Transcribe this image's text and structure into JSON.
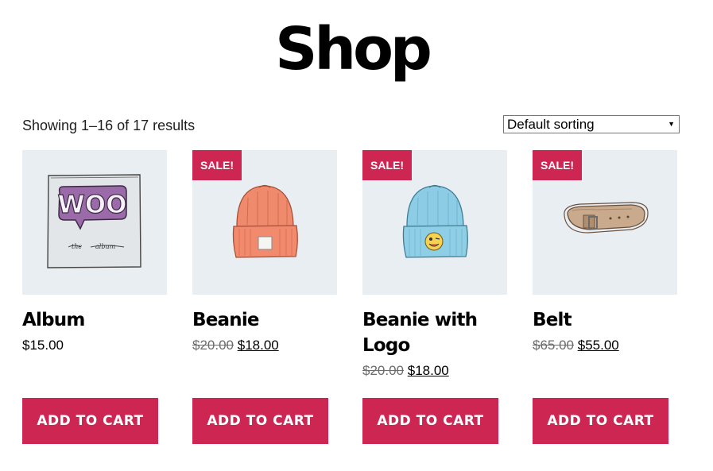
{
  "page": {
    "title": "Shop"
  },
  "toolbar": {
    "result_count": "Showing 1–16 of 17 results",
    "sorting_value": "Default sorting"
  },
  "products": [
    {
      "name": "Album",
      "price": "$15.00",
      "image_icon": "woo-album-icon"
    },
    {
      "name": "Beanie",
      "sale_badge": "SALE!",
      "regular_price": "$20.00",
      "sale_price": "$18.00",
      "image_icon": "orange-beanie-icon"
    },
    {
      "name": "Beanie with Logo",
      "sale_badge": "SALE!",
      "regular_price": "$20.00",
      "sale_price": "$18.00",
      "image_icon": "blue-beanie-logo-icon"
    },
    {
      "name": "Belt",
      "sale_badge": "SALE!",
      "regular_price": "$65.00",
      "sale_price": "$55.00",
      "image_icon": "belt-icon"
    }
  ],
  "buttons": {
    "add_to_cart": "ADD TO CART"
  },
  "colors": {
    "accent": "#cd2653",
    "thumb_bg": "#e9eef3"
  }
}
